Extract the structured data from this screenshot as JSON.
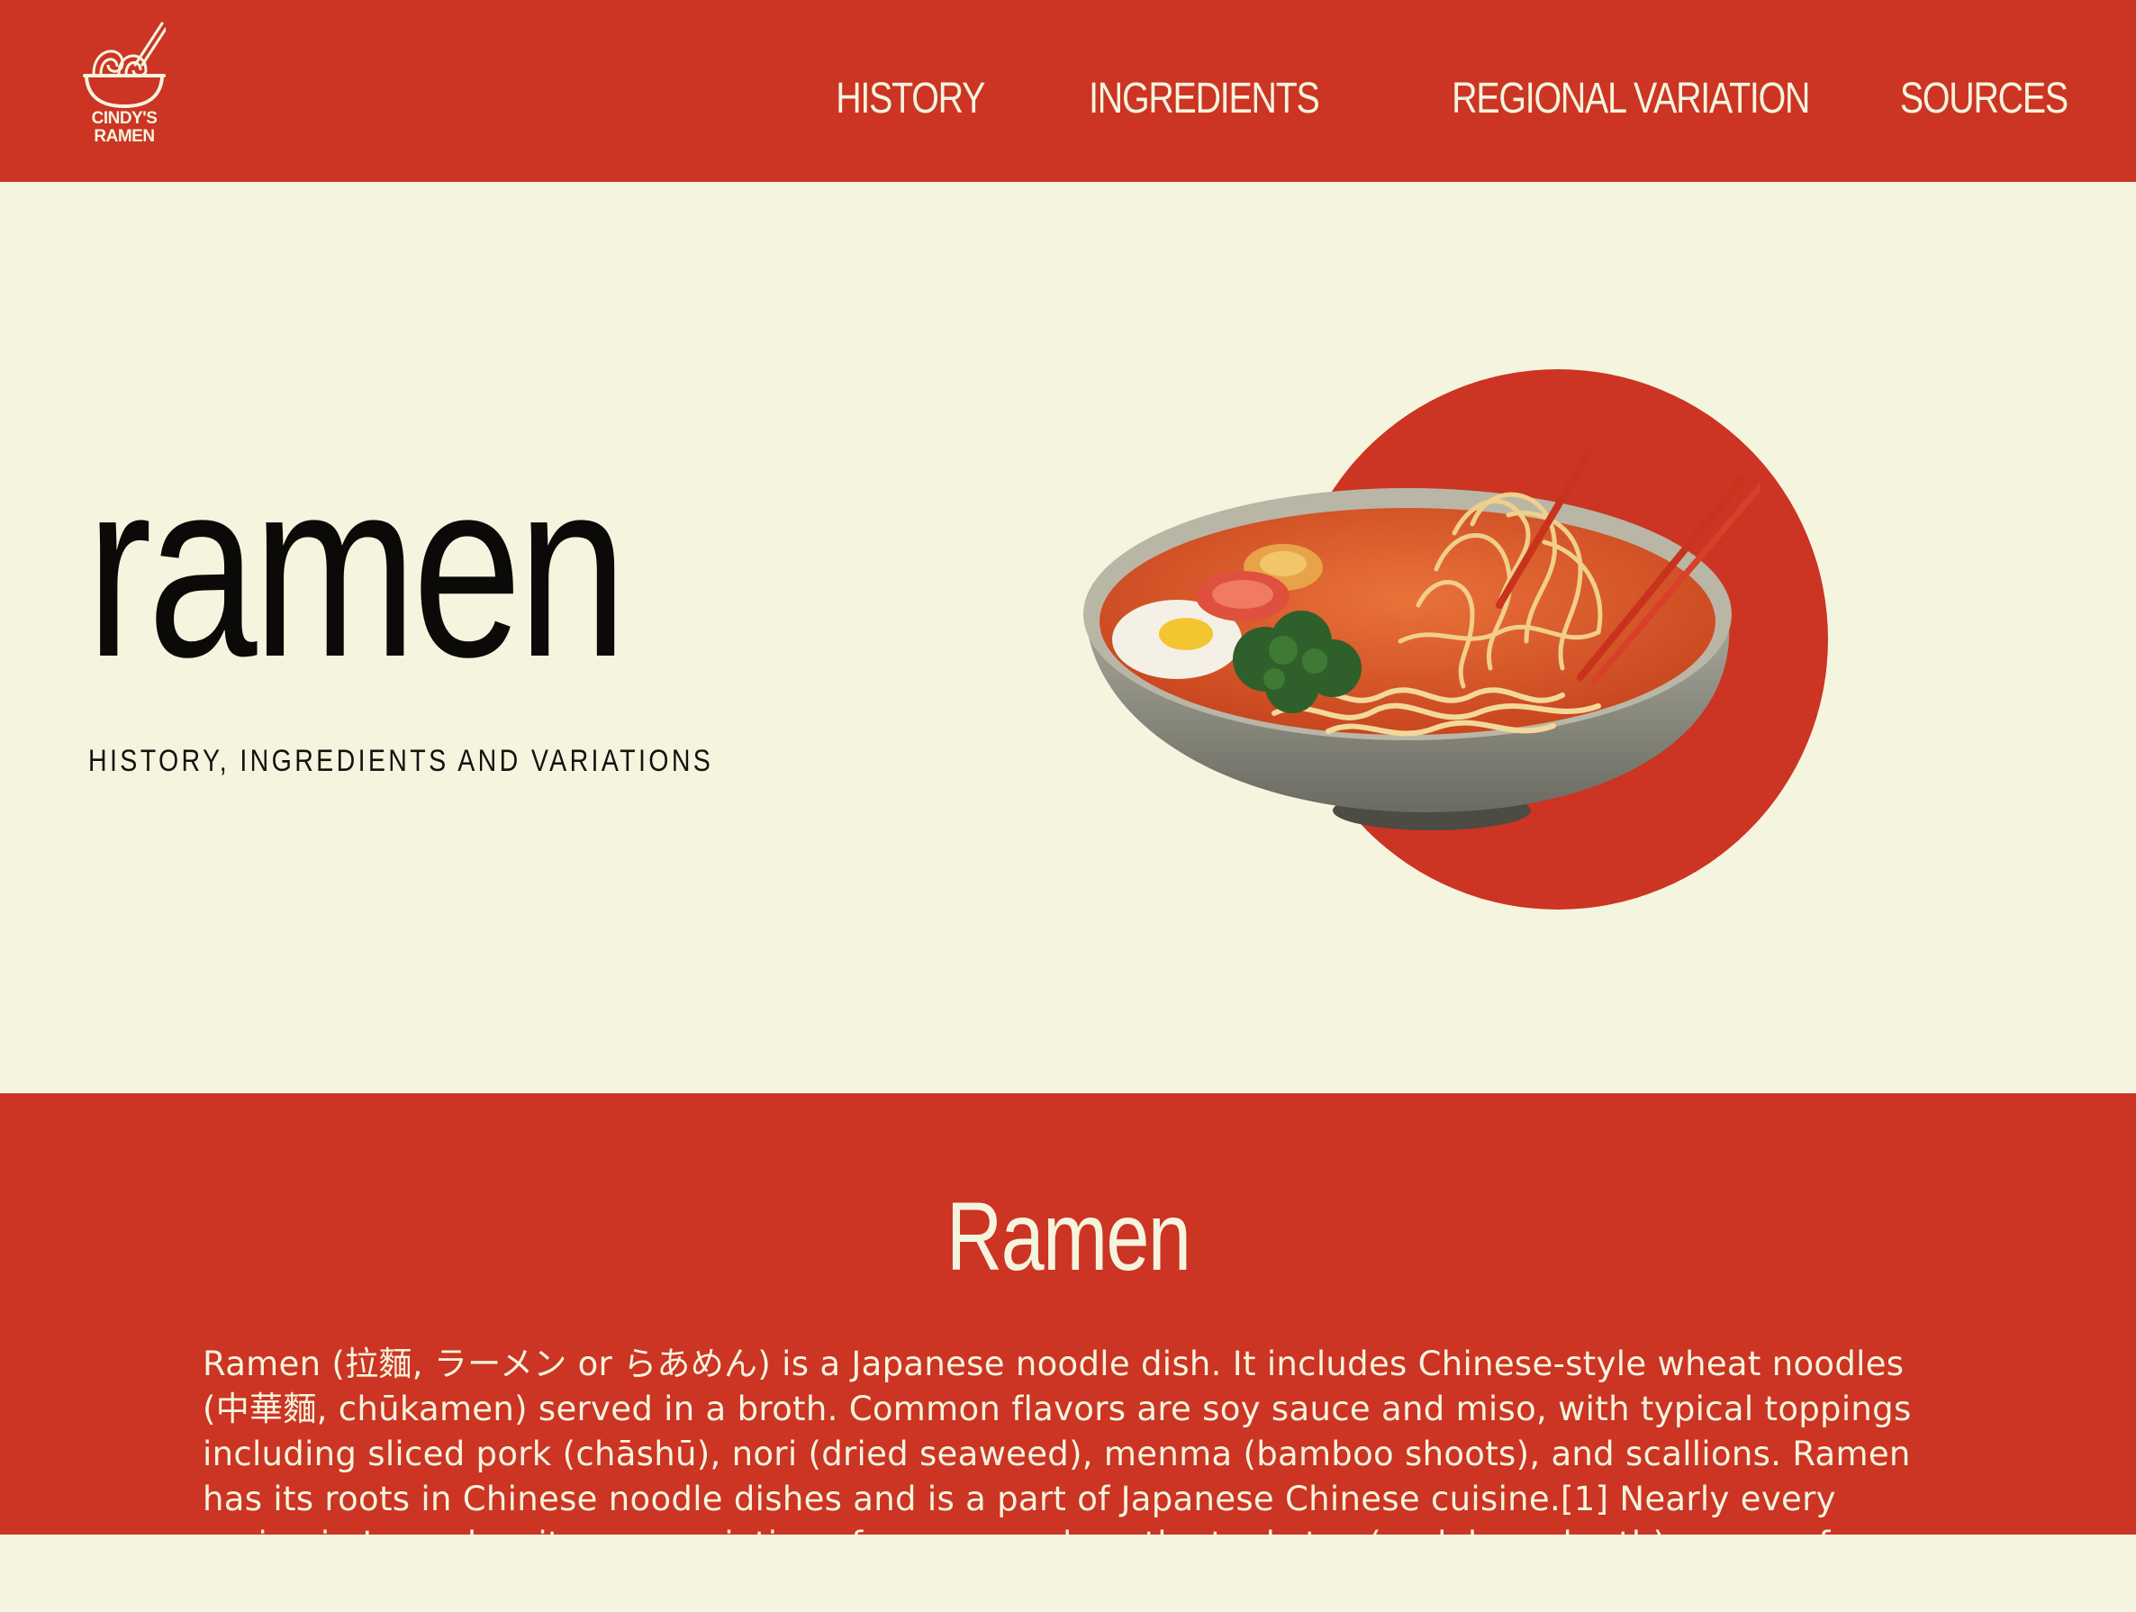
{
  "header": {
    "logo_line1": "CINDY'S",
    "logo_line2": "RAMEN",
    "nav": [
      {
        "label": "HISTORY"
      },
      {
        "label": "INGREDIENTS"
      },
      {
        "label": "REGIONAL VARIATION"
      },
      {
        "label": "SOURCES"
      }
    ]
  },
  "hero": {
    "title": "ramen",
    "subtitle": "HISTORY, INGREDIENTS AND VARIATIONS",
    "image_icon": "ramen-bowl-illustration"
  },
  "content": {
    "title": "Ramen",
    "body": "Ramen (拉麵, ラーメン or らあめん) is a Japanese noodle dish. It includes Chinese-style wheat noodles (中華麵, chūkamen) served in a broth. Common flavors are soy sauce and miso, with typical toppings including sliced pork (chāshū), nori (dried seaweed), menma (bamboo shoots), and scallions. Ramen has its roots in Chinese noodle dishes and is a part of Japanese Chinese cuisine.[1] Nearly every region in Japan has its own variation of ramen, such as the tonkotsu (pork bone broth) ramen of Kyushu and the miso ramen of Hokkaido."
  },
  "colors": {
    "brand_red": "#cc3423",
    "cream": "#f5f4de",
    "text_dark": "#0b0a08"
  }
}
